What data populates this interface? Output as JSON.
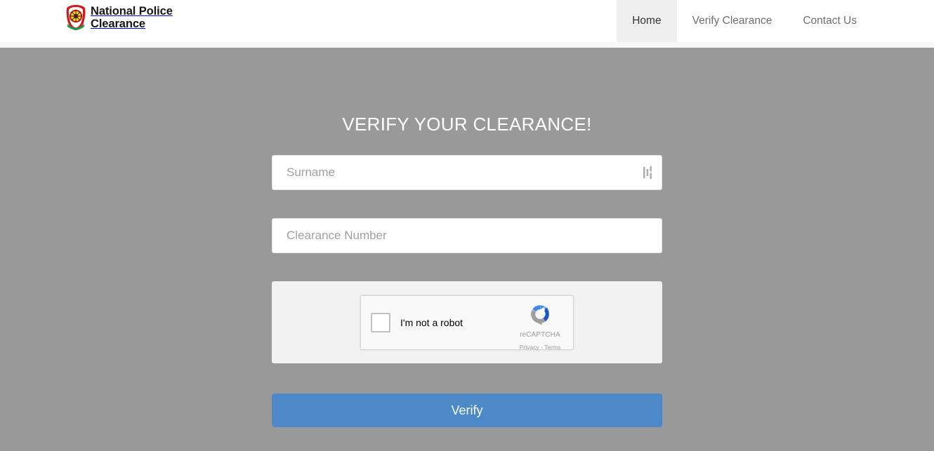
{
  "header": {
    "brand": {
      "line1": "National Police",
      "line2": "Clearance",
      "logo_icon": "police-badge-logo"
    },
    "nav": [
      {
        "label": "Home",
        "active": true
      },
      {
        "label": "Verify Clearance",
        "active": false
      },
      {
        "label": "Contact Us",
        "active": false
      }
    ]
  },
  "main": {
    "title": "VERIFY YOUR CLEARANCE!",
    "fields": [
      {
        "name": "surname",
        "placeholder": "Surname",
        "value": "",
        "icon": "autofill-icon"
      },
      {
        "name": "clearance-number",
        "placeholder": "Clearance Number",
        "value": ""
      }
    ],
    "captcha": {
      "label": "I'm not a robot",
      "brand_name": "reCAPTCHA",
      "links": "Privacy - Terms",
      "logo_icon": "recaptcha-logo",
      "checked": false
    },
    "submit_label": "Verify"
  },
  "colors": {
    "page_background": "#999999",
    "header_background": "#ffffff",
    "nav_active_background": "#efefef",
    "primary_button": "#4d89c9",
    "captcha_panel": "#f2f2f2",
    "title_text": "#ffffff"
  }
}
